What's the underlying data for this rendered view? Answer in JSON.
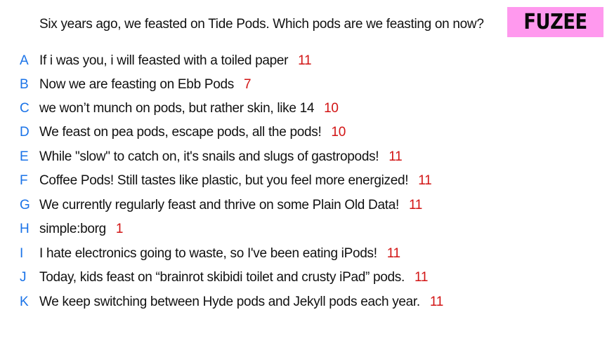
{
  "question": "Six years ago, we feasted on Tide Pods. Which pods are we feasting on now?",
  "logo": {
    "text": "FUZEE",
    "bg_color": "#ff99ee"
  },
  "colors": {
    "letter": "#1a73e8",
    "score": "#d21414"
  },
  "answers": [
    {
      "letter": "A",
      "text": "If i was you, i will feasted with a toiled paper",
      "score": "11"
    },
    {
      "letter": "B",
      "text": "Now we are feasting on Ebb Pods",
      "score": "7"
    },
    {
      "letter": "C",
      "text": "we won’t munch on pods, but rather skin, like 14",
      "score": "10"
    },
    {
      "letter": "D",
      "text": "We feast on pea pods, escape pods, all the pods!",
      "score": "10"
    },
    {
      "letter": "E",
      "text": "While \"slow\" to catch on, it's snails and slugs of gastropods!",
      "score": "11"
    },
    {
      "letter": "F",
      "text": "Coffee Pods! Still tastes like plastic, but you feel more energized!",
      "score": "11"
    },
    {
      "letter": "G",
      "text": "We currently regularly feast and thrive on some Plain Old Data!",
      "score": "11"
    },
    {
      "letter": "H",
      "text": "simple:borg",
      "score": "1"
    },
    {
      "letter": "I",
      "text": "I hate electronics going to waste, so I've been eating iPods!",
      "score": "11"
    },
    {
      "letter": "J",
      "text": "Today, kids feast on “brainrot skibidi toilet and crusty iPad” pods.",
      "score": "11"
    },
    {
      "letter": "K",
      "text": "We keep switching between Hyde pods and Jekyll pods each year.",
      "score": "11"
    }
  ]
}
